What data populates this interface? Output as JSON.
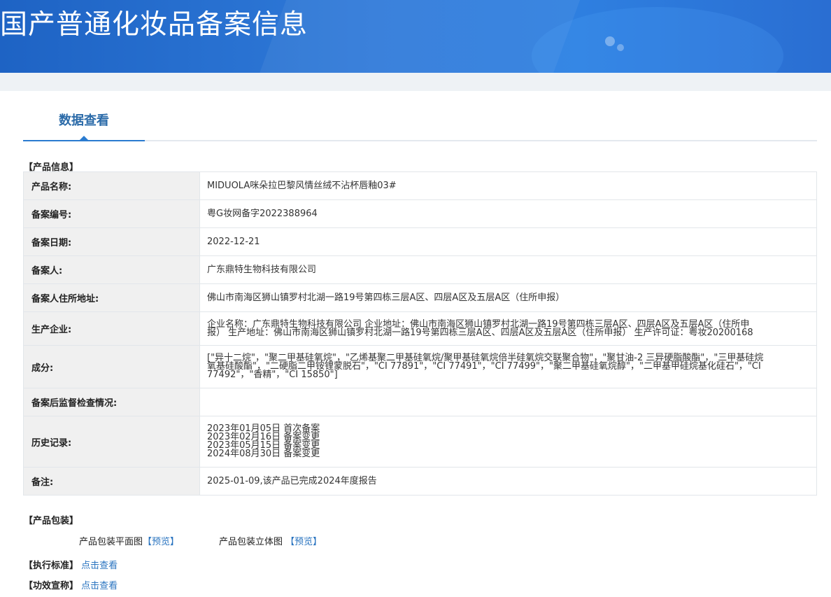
{
  "header": {
    "title": "国产普通化妆品备案信息"
  },
  "tabs": [
    {
      "label": "数据查看"
    }
  ],
  "product_info": {
    "section_title": "【产品信息】",
    "rows": [
      {
        "label": "产品名称:",
        "value": [
          "MIDUOLA咪朵拉巴黎风情丝绒不沾杯唇釉03#"
        ]
      },
      {
        "label": "备案编号:",
        "value": [
          "粤G妆网备字2022388964"
        ]
      },
      {
        "label": "备案日期:",
        "value": [
          "2022-12-21"
        ]
      },
      {
        "label": "备案人:",
        "value": [
          "广东鼎特生物科技有限公司"
        ]
      },
      {
        "label": "备案人住所地址:",
        "value": [
          "佛山市南海区狮山镇罗村北湖一路19号第四栋三层A区、四层A区及五层A区（住所申报）"
        ]
      },
      {
        "label": "生产企业:",
        "value": [
          "企业名称：广东鼎特生物科技有限公司 企业地址：佛山市南海区狮山镇罗村北湖一路19号第四栋三层A区、四层A区及五层A区（住所申",
          "报） 生产地址：佛山市南海区狮山镇罗村北湖一路19号第四栋三层A区、四层A区及五层A区（住所申报） 生产许可证：粤妆20200168"
        ]
      },
      {
        "label": "成分:",
        "value": [
          "[\"异十二烷\"，\"聚二甲基硅氧烷\"，\"乙烯基聚二甲基硅氧烷/聚甲基硅氧烷倍半硅氧烷交联聚合物\"，\"聚甘油-2 三异硬脂酸酯\"，\"三甲基硅烷",
          "氧基硅酸酯\"，\"二硬脂二甲铵锂蒙脱石\"，\"CI 77891\"，\"CI 77491\"，\"CI 77499\"，\"聚二甲基硅氧烷醇\"，\"二甲基甲硅烷基化硅石\"，\"CI",
          "77492\"，\"香精\"，\"CI 15850\"]"
        ]
      },
      {
        "label": "备案后监督检查情况:",
        "value": [
          ""
        ]
      },
      {
        "label": "历史记录:",
        "value": [
          "2023年01月05日 首次备案",
          "2023年02月16日 备案变更",
          "2023年05月15日 备案变更",
          "2024年08月30日 备案变更"
        ]
      },
      {
        "label": "备注:",
        "value": [
          "2025-01-09,该产品已完成2024年度报告"
        ]
      }
    ]
  },
  "packaging": {
    "section_title": "【产品包装】",
    "flat_label": "产品包装平面图",
    "flat_link": "【预览】",
    "solid_label": "产品包装立体图",
    "solid_link": "【预览】"
  },
  "standard": {
    "label": "【执行标准】",
    "link": "点击查看"
  },
  "efficacy": {
    "label": "【功效宣称】",
    "link": "点击查看"
  }
}
